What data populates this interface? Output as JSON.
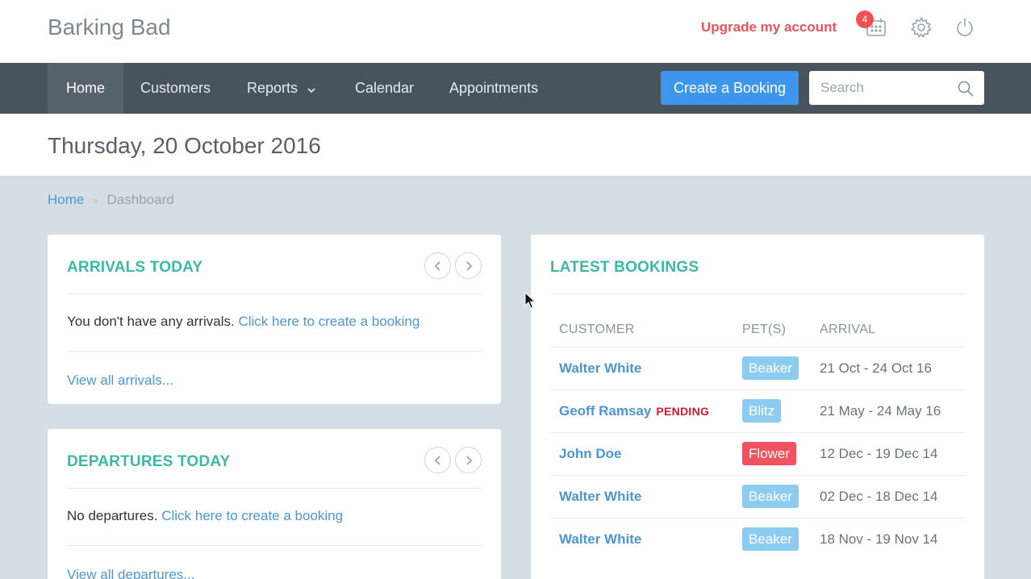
{
  "app": {
    "brand": "Barking Bad"
  },
  "header": {
    "upgrade_label": "Upgrade my account",
    "notification_count": "4",
    "icons": [
      "calendar-icon",
      "gear-icon",
      "power-icon"
    ]
  },
  "nav": {
    "items": [
      {
        "label": "Home",
        "active": true
      },
      {
        "label": "Customers"
      },
      {
        "label": "Reports"
      },
      {
        "label": "Calendar"
      },
      {
        "label": "Appointments"
      }
    ],
    "create_booking": "Create a Booking",
    "search_placeholder": "Search"
  },
  "page": {
    "date_title": "Thursday, 20 October 2016"
  },
  "breadcrumb": {
    "home": "Home",
    "current": "Dashboard"
  },
  "arrivals": {
    "title": "ARRIVALS TODAY",
    "empty_text": "You don't have any arrivals.",
    "create_link": "Click here to create a booking",
    "view_all": "View all arrivals..."
  },
  "departures": {
    "title": "DEPARTURES TODAY",
    "empty_text": "No departures.",
    "create_link": "Click here to create a booking",
    "view_all": "View all departures..."
  },
  "bookings": {
    "title": "LATEST BOOKINGS",
    "columns": [
      "CUSTOMER",
      "PET(S)",
      "ARRIVAL"
    ],
    "rows": [
      {
        "customer": "Walter White",
        "status": "",
        "pet": "Beaker",
        "pet_color": "#8cccf0",
        "arrival": "21 Oct - 24 Oct 16"
      },
      {
        "customer": "Geoff Ramsay",
        "status": "PENDING",
        "pet": "Blitz",
        "pet_color": "#8cccf0",
        "arrival": "21 May - 24 May 16"
      },
      {
        "customer": "John Doe",
        "status": "",
        "pet": "Flower",
        "pet_color": "#ef5360",
        "arrival": "12 Dec - 19 Dec 14"
      },
      {
        "customer": "Walter White",
        "status": "",
        "pet": "Beaker",
        "pet_color": "#8cccf0",
        "arrival": "02 Dec - 18 Dec 14"
      },
      {
        "customer": "Walter White",
        "status": "",
        "pet": "Beaker",
        "pet_color": "#8cccf0",
        "arrival": "18 Nov - 19 Nov 14"
      }
    ]
  }
}
